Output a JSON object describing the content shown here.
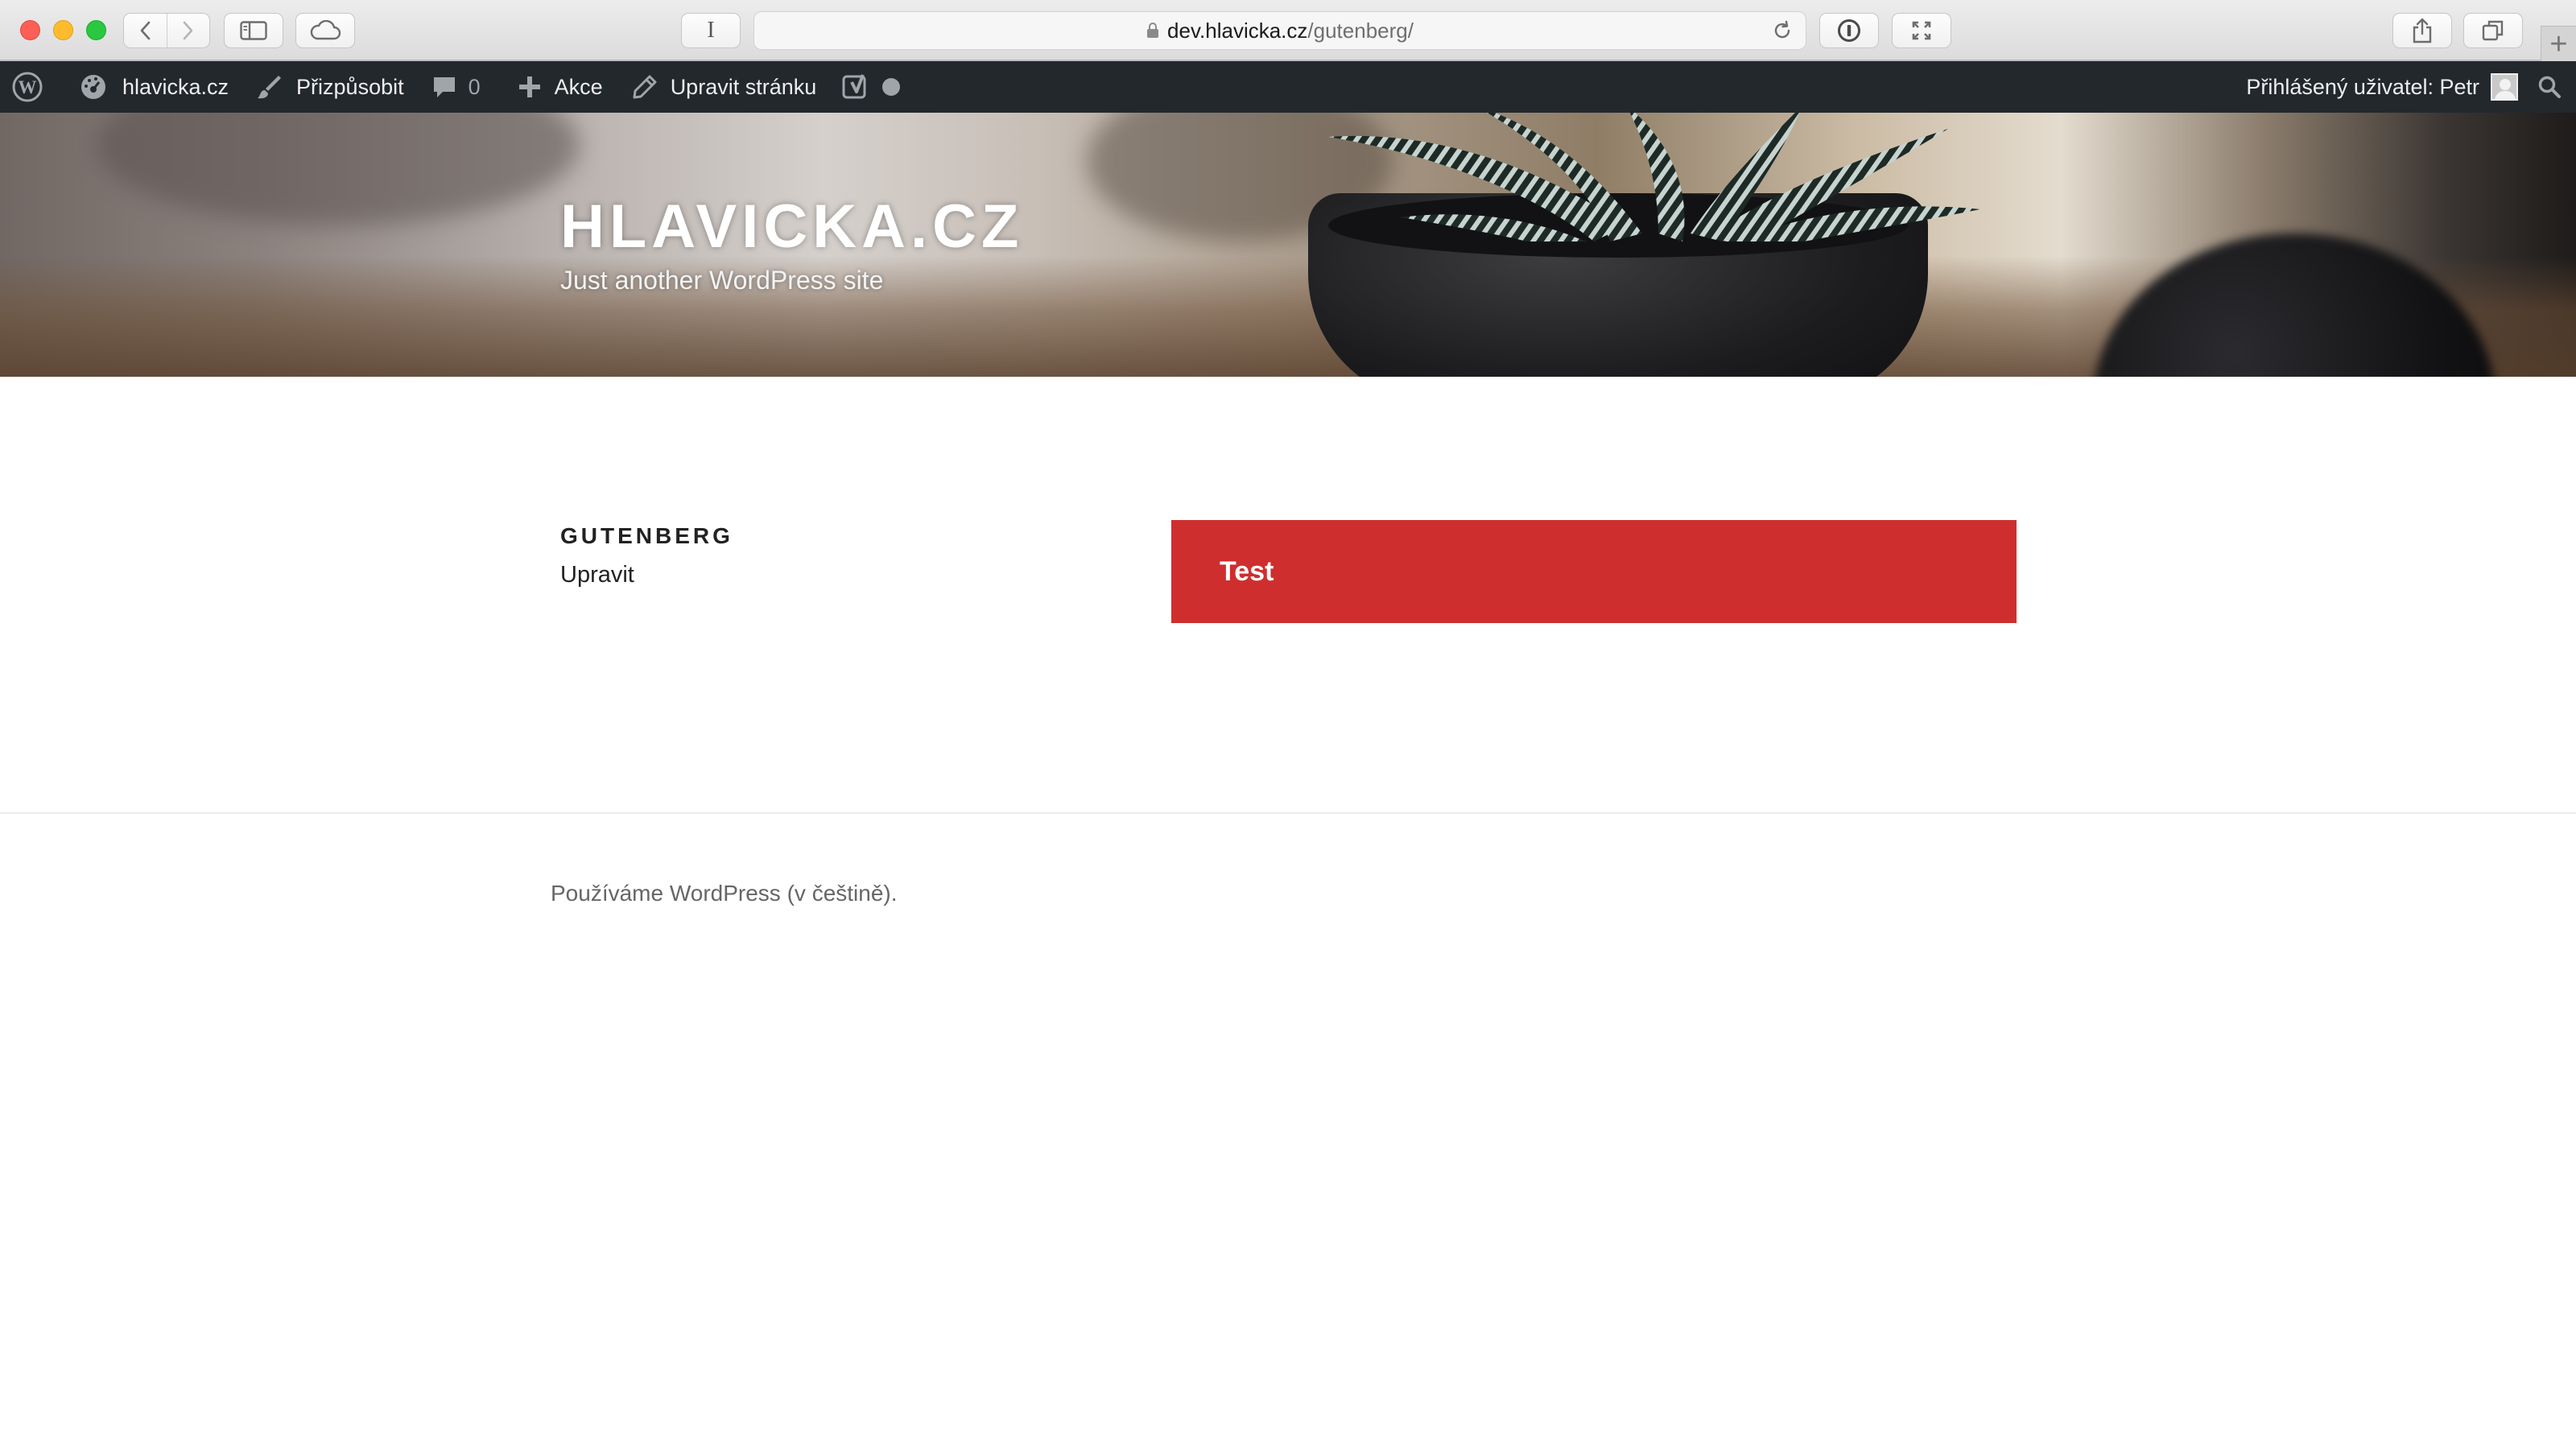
{
  "browser": {
    "url_host": "dev.hlavicka.cz",
    "url_path": "/gutenberg/",
    "reader_label": "I",
    "new_tab_label": "+"
  },
  "admin_bar": {
    "site_name": "hlavicka.cz",
    "customize_label": "Přizpůsobit",
    "comments_count": "0",
    "new_label": "Akce",
    "edit_page_label": "Upravit stránku",
    "greeting": "Přihlášený uživatel: Petr"
  },
  "header": {
    "site_title": "HLAVICKA.CZ",
    "tagline": "Just another WordPress site"
  },
  "content": {
    "page_title": "GUTENBERG",
    "edit_label": "Upravit",
    "block_text": "Test",
    "block_color": "#cf2e2e"
  },
  "footer": {
    "credit": "Používáme WordPress (v češtině)."
  }
}
